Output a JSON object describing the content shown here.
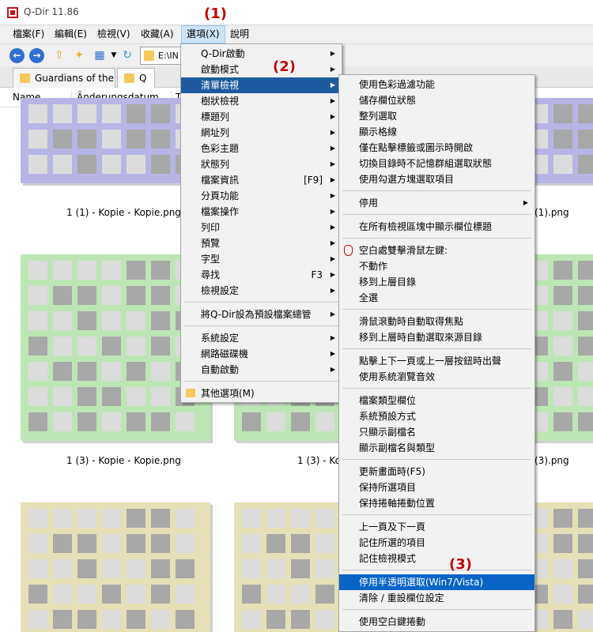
{
  "window": {
    "title": "Q-Dir 11.86"
  },
  "menubar": {
    "items": [
      "檔案(F)",
      "編輯(E)",
      "檢視(V)",
      "收藏(A)",
      "選項(X)",
      "說明"
    ],
    "active_index": 4
  },
  "toolbar": {
    "address_text": "E:\\IN"
  },
  "tabs": {
    "items": [
      "Guardians of the ...",
      "Q"
    ]
  },
  "columns": {
    "name": "Name",
    "date": "Änderungsdatum",
    "type": "T"
  },
  "badges": {
    "b1": "(1)",
    "b2": "(2)",
    "b3": "(3)"
  },
  "files": {
    "row1_left": "1 (1) - Kopie - Kopie.png",
    "row1_right": "(1).png",
    "row2_left": "1 (3) - Kopie - Kopie.png",
    "row2_mid": "1 (3) - Ko",
    "row2_right": "(3).png"
  },
  "colors": {
    "row1_fill": "#b7b5e6",
    "row2_fill": "#bde6b5",
    "row3_fill": "#e6e0b7",
    "tile_gray": "#a8a8a8",
    "tile_light": "#dcdcdc",
    "highlight": "#0a64c6"
  },
  "options_menu": {
    "items": [
      {
        "label": "Q-Dir啟動",
        "shortcut": "",
        "arrow": true
      },
      {
        "label": "啟動模式",
        "shortcut": "",
        "arrow": true
      },
      {
        "label": "清單檢視",
        "shortcut": "",
        "arrow": true
      },
      {
        "label": "樹狀檢視",
        "shortcut": "",
        "arrow": true
      },
      {
        "label": "標題列",
        "shortcut": "",
        "arrow": true
      },
      {
        "label": "網址列",
        "shortcut": "",
        "arrow": true
      },
      {
        "label": "色彩主題",
        "shortcut": "",
        "arrow": true
      },
      {
        "label": "狀態列",
        "shortcut": "",
        "arrow": true
      },
      {
        "label": "檔案資訊",
        "shortcut": "[F9]",
        "arrow": true
      },
      {
        "label": "分頁功能",
        "shortcut": "",
        "arrow": true
      },
      {
        "label": "檔案操作",
        "shortcut": "",
        "arrow": true
      },
      {
        "label": "列印",
        "shortcut": "",
        "arrow": true
      },
      {
        "label": "預覽",
        "shortcut": "",
        "arrow": true
      },
      {
        "label": "字型",
        "shortcut": "",
        "arrow": true
      },
      {
        "label": "尋找",
        "shortcut": "F3",
        "arrow": true
      },
      {
        "label": "檢視設定",
        "shortcut": "",
        "arrow": true
      },
      {
        "label": "將Q-Dir設為預設檔案總管",
        "shortcut": "",
        "arrow": true
      },
      {
        "label": "系統設定",
        "shortcut": "",
        "arrow": true
      },
      {
        "label": "網路磁碟機",
        "shortcut": "",
        "arrow": true
      },
      {
        "label": "自動啟動",
        "shortcut": "",
        "arrow": true
      },
      {
        "label": "其他選項(M)",
        "shortcut": "",
        "arrow": false
      }
    ],
    "highlighted_index": 2
  },
  "list_view_submenu": {
    "items": [
      {
        "label": "使用色彩過濾功能"
      },
      {
        "label": "儲存欄位狀態"
      },
      {
        "label": "整列選取"
      },
      {
        "label": "顯示格線"
      },
      {
        "label": "僅在點擊標籤或圖示時開啟"
      },
      {
        "label": "切換目錄時不記憶群組選取狀態"
      },
      {
        "label": "使用勾選方塊選取項目"
      },
      {
        "label": "停用",
        "arrow": true
      },
      {
        "label": "在所有檢視區塊中顯示欄位標題"
      },
      {
        "label": "空白處雙擊滑鼠左鍵:"
      },
      {
        "label": "不動作"
      },
      {
        "label": "移到上層目錄"
      },
      {
        "label": "全選"
      },
      {
        "label": "滑鼠滾動時自動取得焦點"
      },
      {
        "label": "移到上層時自動選取來源目錄"
      },
      {
        "label": "點擊上下一頁或上一層按鈕時出聲"
      },
      {
        "label": "使用系統瀏覽音效"
      },
      {
        "label": "檔案類型欄位"
      },
      {
        "label": "系統預設方式"
      },
      {
        "label": "只顯示副檔名"
      },
      {
        "label": "顯示副檔名與類型"
      },
      {
        "label": "更新畫面時(F5)"
      },
      {
        "label": "保持所選項目"
      },
      {
        "label": "保持捲軸捲動位置"
      },
      {
        "label": "上一頁及下一頁"
      },
      {
        "label": "記住所選的項目"
      },
      {
        "label": "記住檢視模式"
      },
      {
        "label": "停用半透明選取(Win7/Vista)"
      },
      {
        "label": "清除 / 重設欄位設定"
      },
      {
        "label": "使用空白鍵捲動"
      }
    ],
    "highlighted_index": 27
  }
}
